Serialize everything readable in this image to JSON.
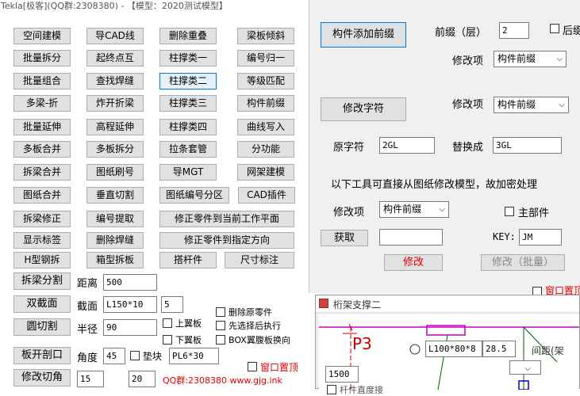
{
  "left": {
    "title": "Tekla[极客](QQ群:2308380) - 【模型：2020测试模型】",
    "buttons": [
      [
        "空间建模",
        "导CAD线",
        "删除重叠",
        "梁板倾斜"
      ],
      [
        "批量拆分",
        "起终点互",
        "柱撑类一",
        "编号归一"
      ],
      [
        "批量组合",
        "查找焊缝",
        "柱撑类二",
        "等级匹配"
      ],
      [
        "多梁-折",
        "炸开折梁",
        "柱撑类三",
        "构件前缀"
      ],
      [
        "批量延伸",
        "高程延伸",
        "柱撑类四",
        "曲线写入"
      ],
      [
        "多板合并",
        "多板拆分",
        "拉条套管",
        "分功能"
      ],
      [
        "拆梁合并",
        "图纸刷号",
        "导MGT",
        "网架建模"
      ],
      [
        "图纸合并",
        "垂直切割",
        "图纸编号分区",
        "CAD插件"
      ]
    ],
    "row9": [
      "拆梁修正",
      "编号提取",
      "修正零件到当前工作平面"
    ],
    "row10": [
      "显示标签",
      "删除焊缝",
      "修正零件到指定方向"
    ],
    "row11": [
      "H型钢拆",
      "箱型拆板",
      "搭杆件",
      "尺寸标注"
    ],
    "split_beam": "拆梁分割",
    "distance_label": "距离",
    "distance_value": "500",
    "double_section": "双截面",
    "section_label": "截面",
    "section_value": "L150*10",
    "section_count": "5",
    "delete_original": "删除原零件",
    "round_cut": "圆切割",
    "radius_label": "半径",
    "radius_value": "90",
    "upper_flange": "上翼板",
    "select_then_exec": "先选择后执行",
    "lower_flange": "下翼板",
    "box_web_swap": "BOX翼腹板换向",
    "plate_open": "板开剖口",
    "angle_label": "角度",
    "angle_value": "45",
    "shim_label": "垫块",
    "shim_value": "PL6*30",
    "window_top": "窗口置顶",
    "modify_chamfer": "修改切角",
    "chamfer_a": "15",
    "chamfer_b": "20",
    "footer": "QQ群:2308380  www.gjg.ink"
  },
  "right": {
    "add_prefix": "构件添加前缀",
    "prefix_layer_label": "前缀（层）",
    "prefix_value": "2",
    "suffix_label": "后缀",
    "modify_item_label": "修改项",
    "modify_item_value": "构件前缀",
    "modify_char": "修改字符",
    "modify_item_label2": "修改项",
    "modify_item_value2": "构件前缀",
    "orig_char_label": "原字符",
    "orig_char_value": "2GL",
    "replace_label": "替换成",
    "replace_value": "3GL",
    "notice": "以下工具可直接从图纸修改模型，故加密处理",
    "modify_item_label3": "修改项",
    "modify_item_value3": "构件前缀",
    "main_part": "主部件",
    "fetch": "获取",
    "key_label": "KEY:",
    "key_value": "JM",
    "modify": "修改",
    "modify_batch": "修改（批量）",
    "window_top": "窗口置顶"
  },
  "cad": {
    "title": "桁架支撑二",
    "label_p3": "P3",
    "member_value": "L100*80*8",
    "member_offset": "28.5",
    "spacing_label": "间距(架",
    "length_value": "1500",
    "bottom_cut": "杆件直度接"
  }
}
